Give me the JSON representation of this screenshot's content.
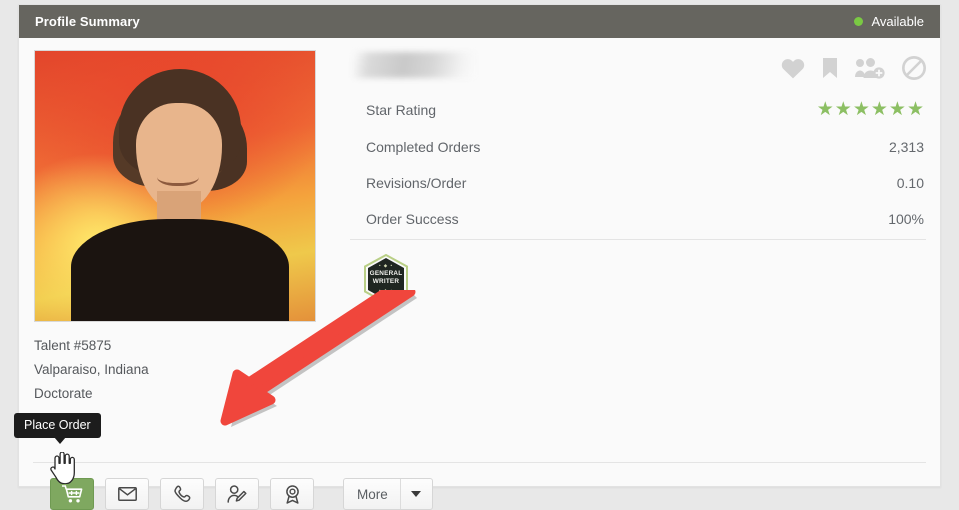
{
  "header": {
    "title": "Profile Summary",
    "availability_label": "Available",
    "availability_color": "#7ac943",
    "bar_color": "#66655f"
  },
  "profile": {
    "name_redacted": true,
    "photo_alt": "talent-portrait",
    "talent_id": "Talent #5875",
    "location": "Valparaiso, Indiana",
    "education": "Doctorate"
  },
  "top_actions": [
    {
      "name": "favorite-icon",
      "label": "Favorite"
    },
    {
      "name": "bookmark-icon",
      "label": "Bookmark"
    },
    {
      "name": "add-to-team-icon",
      "label": "Add to team"
    },
    {
      "name": "block-icon",
      "label": "Block"
    }
  ],
  "stats": {
    "rows": [
      {
        "label": "Star Rating",
        "value": "",
        "type": "stars",
        "stars": 6
      },
      {
        "label": "Completed Orders",
        "value": "2,313",
        "type": "text"
      },
      {
        "label": "Revisions/Order",
        "value": "0.10",
        "type": "text"
      },
      {
        "label": "Order Success",
        "value": "100%",
        "type": "text"
      }
    ],
    "star_color": "#8cbf63",
    "star_glyph": "★"
  },
  "badge": {
    "line1": "GENERAL",
    "line2": "WRITER",
    "dots": "• ◆ •",
    "fill": "#1f2621",
    "border": "#b9cf86"
  },
  "toolbar": {
    "place_order_label": "Place Order",
    "place_order_color": "#7fa860",
    "buttons": [
      {
        "name": "place-order-button",
        "icon": "shopping-cart-icon",
        "label": "Place Order",
        "primary": true
      },
      {
        "name": "message-button",
        "icon": "envelope-icon",
        "label": "Message"
      },
      {
        "name": "call-button",
        "icon": "phone-icon",
        "label": "Call"
      },
      {
        "name": "edit-talent-button",
        "icon": "user-edit-icon",
        "label": "Edit"
      },
      {
        "name": "award-button",
        "icon": "award-icon",
        "label": "Award"
      }
    ],
    "more_label": "More"
  },
  "annotation": {
    "arrow_color": "#f0463c",
    "points_to": "place-order-button"
  }
}
